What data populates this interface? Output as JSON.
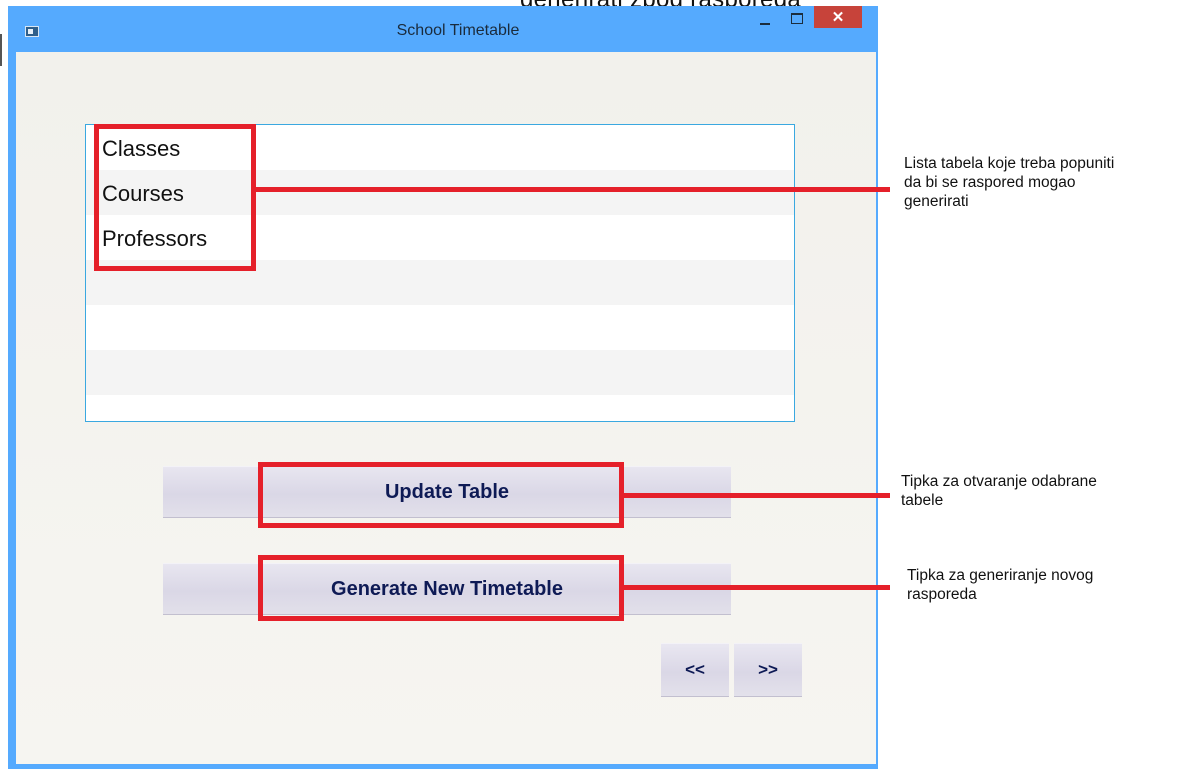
{
  "window": {
    "title": "School Timetable",
    "close_symbol": "✕"
  },
  "top_crop_text": "generirati zbog rasporeda",
  "listbox": {
    "items": [
      {
        "label": "Classes"
      },
      {
        "label": "Courses"
      },
      {
        "label": "Professors"
      }
    ]
  },
  "buttons": {
    "update_label": "Update Table",
    "generate_label": "Generate New Timetable",
    "prev_label": "<<",
    "next_label": ">>"
  },
  "annotations": {
    "list_note": "Lista tabela koje treba popuniti\nda bi se raspored mogao\ngenerirati",
    "update_note": "Tipka za otvaranje odabrane\ntabele",
    "generate_note": "Tipka za generiranje novog\nrasporeda"
  },
  "colors": {
    "highlight": "#e5202a",
    "titlebar": "#55aafe",
    "button_text": "#0e1a55",
    "listbox_border": "#3aa8e0"
  },
  "icons": {
    "app": "app-window-icon",
    "minimize": "minimize-icon",
    "maximize": "maximize-icon",
    "close": "close-icon"
  }
}
